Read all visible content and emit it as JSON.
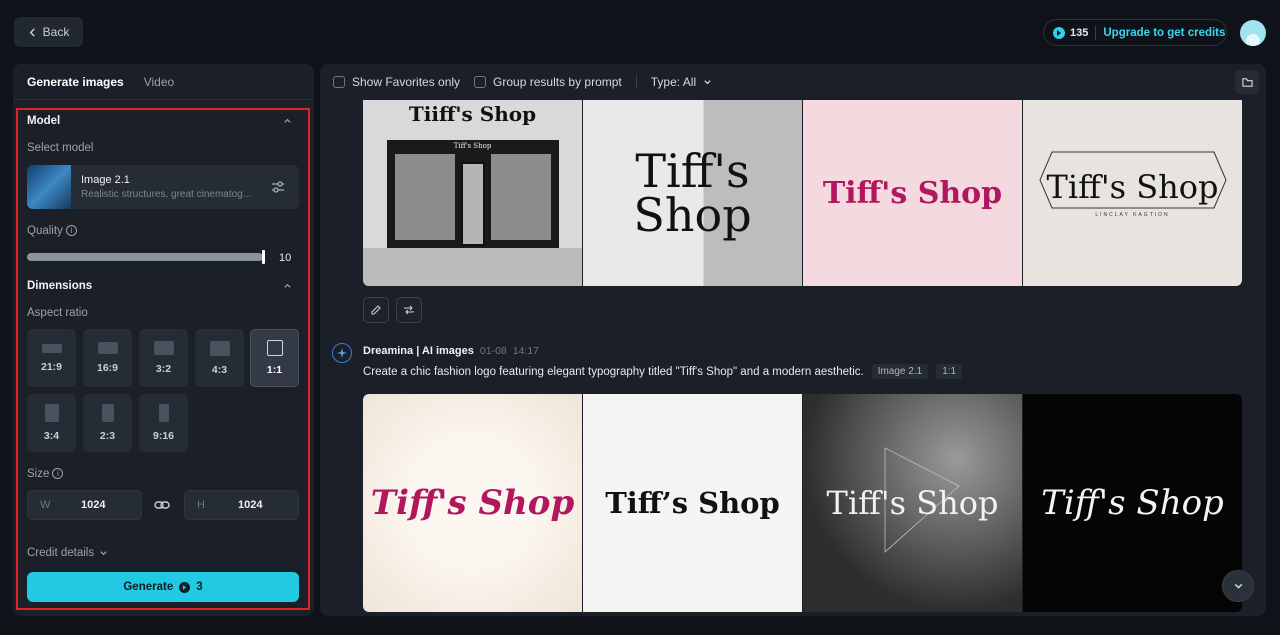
{
  "header": {
    "back_label": "Back",
    "credits_count": "135",
    "upgrade_label": "Upgrade to get credits"
  },
  "sidebar": {
    "tabs": [
      {
        "label": "Generate images",
        "active": true
      },
      {
        "label": "Video",
        "active": false
      }
    ],
    "model_section": "Model",
    "select_model_label": "Select model",
    "model": {
      "name": "Image 2.1",
      "description": "Realistic structures, great cinematog..."
    },
    "quality_label": "Quality",
    "quality_value": "10",
    "quality_fraction": 1.0,
    "dimensions_section": "Dimensions",
    "aspect_ratio_label": "Aspect ratio",
    "aspect_ratios": [
      {
        "label": "21:9",
        "active": false
      },
      {
        "label": "16:9",
        "active": false
      },
      {
        "label": "3:2",
        "active": false
      },
      {
        "label": "4:3",
        "active": false
      },
      {
        "label": "1:1",
        "active": true
      },
      {
        "label": "3:4",
        "active": false
      },
      {
        "label": "2:3",
        "active": false
      },
      {
        "label": "9:16",
        "active": false
      }
    ],
    "size_label": "Size",
    "width_key": "W",
    "width_value": "1024",
    "height_key": "H",
    "height_value": "1024",
    "credit_details_label": "Credit details",
    "generate_label": "Generate",
    "generate_cost": "3"
  },
  "main": {
    "filters": {
      "favorites_label": "Show Favorites only",
      "group_label": "Group results by prompt",
      "type_label": "Type: All"
    },
    "batch1": {
      "images": [
        {
          "kind": "storefront",
          "sign_text": "Tiiff's Shop",
          "awning_text": "Tiff's Shop"
        },
        {
          "kind": "serif-stacked",
          "line1": "Tiff's",
          "line2": "Shop"
        },
        {
          "kind": "pink",
          "text": "Tiff's Shop"
        },
        {
          "kind": "hexagon",
          "text": "Tiff's Shop",
          "subtext": "LINCLAY KAGTION"
        }
      ]
    },
    "batch2": {
      "author": "Dreamina | AI images",
      "date": "01-08",
      "time": "14:17",
      "prompt": "Create a chic fashion logo featuring elegant typography titled \"Tiff's Shop\" and a modern aesthetic.",
      "tags": [
        "Image 2.1",
        "1:1"
      ],
      "images": [
        {
          "kind": "cream-script",
          "text": "Tiff's Shop"
        },
        {
          "kind": "white-serif",
          "text": "Tiff’s Shop"
        },
        {
          "kind": "dark-gradient",
          "text": "Tiff's Shop"
        },
        {
          "kind": "black-script",
          "text": "Tiff's Shop"
        }
      ]
    }
  },
  "colors": {
    "accent": "#21c9e3",
    "highlight_border": "#e22326",
    "pink_logo": "#b0175f"
  }
}
